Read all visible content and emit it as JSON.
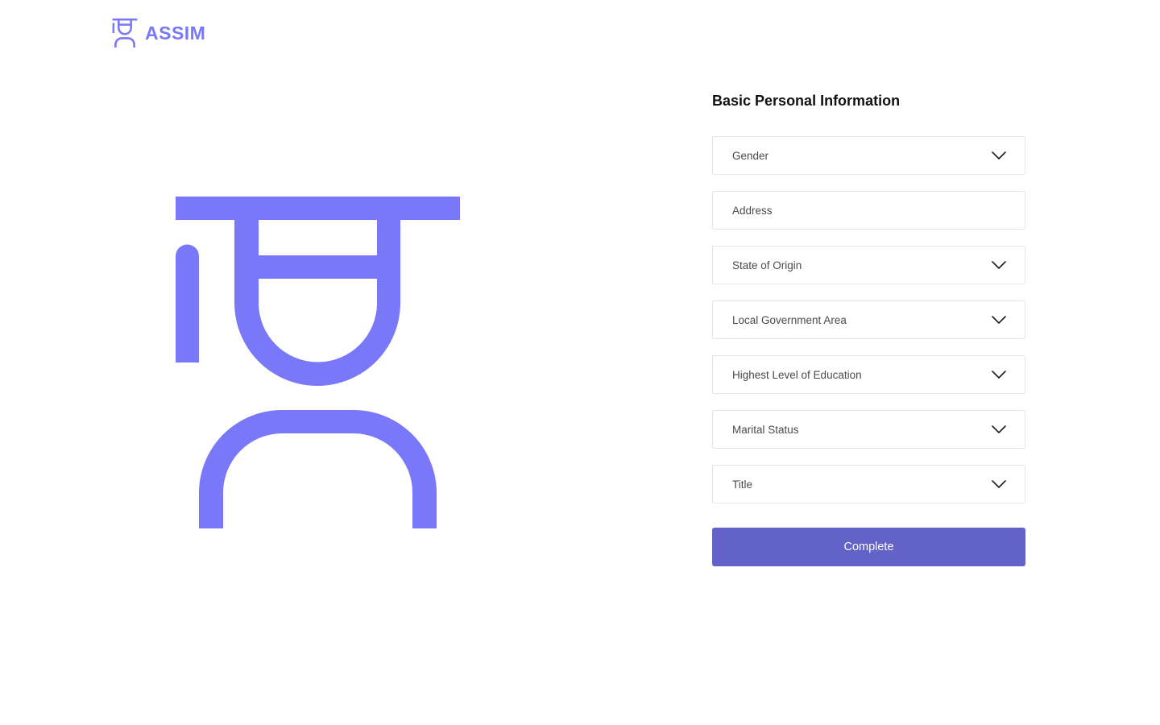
{
  "colors": {
    "brand": "#7878F8",
    "button": "#6262C8",
    "field_border": "#E6E6E6"
  },
  "header": {
    "logo_text": "ASSIM",
    "logo_icon": "graduate-person-icon"
  },
  "hero": {
    "icon": "graduate-person-illustration"
  },
  "form": {
    "title": "Basic Personal Information",
    "fields": [
      {
        "label": "Gender",
        "type": "select",
        "icon": "chevron-down-icon"
      },
      {
        "placeholder": "Address",
        "type": "text"
      },
      {
        "label": "State of Origin",
        "type": "select",
        "icon": "chevron-down-icon"
      },
      {
        "label": "Local Government Area",
        "type": "select",
        "icon": "chevron-down-icon"
      },
      {
        "label": "Highest Level of Education",
        "type": "select",
        "icon": "chevron-down-icon"
      },
      {
        "label": "Marital Status",
        "type": "select",
        "icon": "chevron-down-icon"
      },
      {
        "label": "Title",
        "type": "select",
        "icon": "chevron-down-icon"
      }
    ],
    "submit_label": "Complete"
  }
}
